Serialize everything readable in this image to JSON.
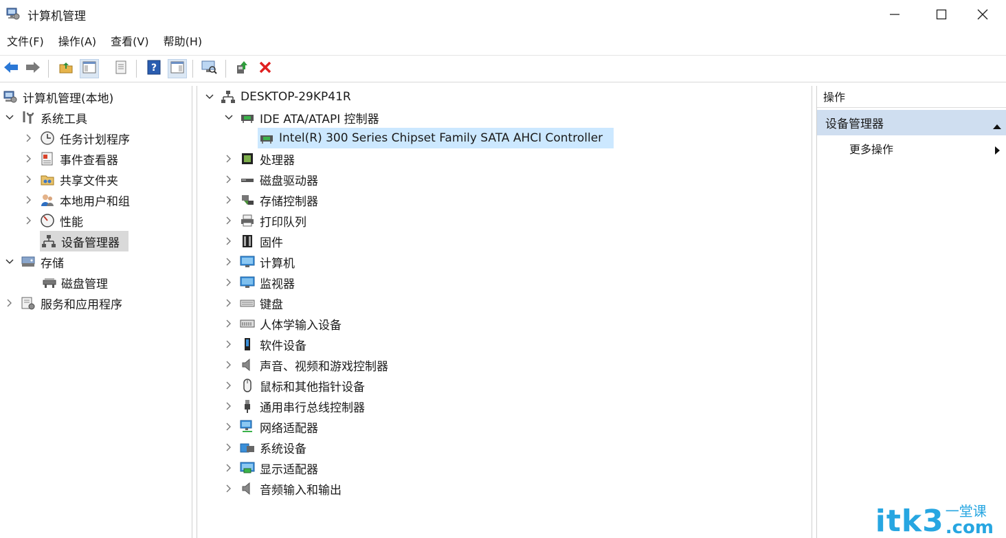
{
  "window": {
    "title": "计算机管理",
    "minimize_icon": "minimize-icon",
    "maximize_icon": "maximize-icon",
    "close_icon": "close-icon"
  },
  "menu": [
    "文件(F)",
    "操作(A)",
    "查看(V)",
    "帮助(H)"
  ],
  "toolbar": [
    "back-arrow-icon",
    "forward-arrow-icon",
    "up-folder-icon",
    "show-hide-tree-icon",
    "properties-icon",
    "help-icon",
    "action-pane-icon",
    "scan-hardware-icon",
    "update-driver-icon",
    "uninstall-x-icon"
  ],
  "tree": {
    "root": "计算机管理(本地)",
    "system_tools": "系统工具",
    "task_scheduler": "任务计划程序",
    "event_viewer": "事件查看器",
    "shared_folders": "共享文件夹",
    "local_users": "本地用户和组",
    "performance": "性能",
    "device_manager": "设备管理器",
    "storage": "存储",
    "disk_management": "磁盘管理",
    "services_apps": "服务和应用程序"
  },
  "devices": {
    "computer_name": "DESKTOP-29KP41R",
    "ide_category": "IDE ATA/ATAPI 控制器",
    "ide_child": "Intel(R) 300 Series Chipset Family SATA AHCI Controller",
    "categories": [
      {
        "label": "处理器",
        "icon": "processor-icon"
      },
      {
        "label": "磁盘驱动器",
        "icon": "disk-drive-icon"
      },
      {
        "label": "存储控制器",
        "icon": "storage-controller-icon"
      },
      {
        "label": "打印队列",
        "icon": "printer-icon"
      },
      {
        "label": "固件",
        "icon": "firmware-icon"
      },
      {
        "label": "计算机",
        "icon": "computer-icon"
      },
      {
        "label": "监视器",
        "icon": "monitor-icon"
      },
      {
        "label": "键盘",
        "icon": "keyboard-icon"
      },
      {
        "label": "人体学输入设备",
        "icon": "hid-icon"
      },
      {
        "label": "软件设备",
        "icon": "software-device-icon"
      },
      {
        "label": "声音、视频和游戏控制器",
        "icon": "speaker-icon"
      },
      {
        "label": "鼠标和其他指针设备",
        "icon": "mouse-icon"
      },
      {
        "label": "通用串行总线控制器",
        "icon": "usb-icon"
      },
      {
        "label": "网络适配器",
        "icon": "network-adapter-icon"
      },
      {
        "label": "系统设备",
        "icon": "system-device-icon"
      },
      {
        "label": "显示适配器",
        "icon": "display-adapter-icon"
      },
      {
        "label": "音频输入和输出",
        "icon": "audio-io-icon"
      }
    ]
  },
  "actions": {
    "header": "操作",
    "section": "设备管理器",
    "more": "更多操作"
  },
  "watermark": {
    "main": "itk3",
    "sub": "一堂课",
    "tld": ".com"
  }
}
